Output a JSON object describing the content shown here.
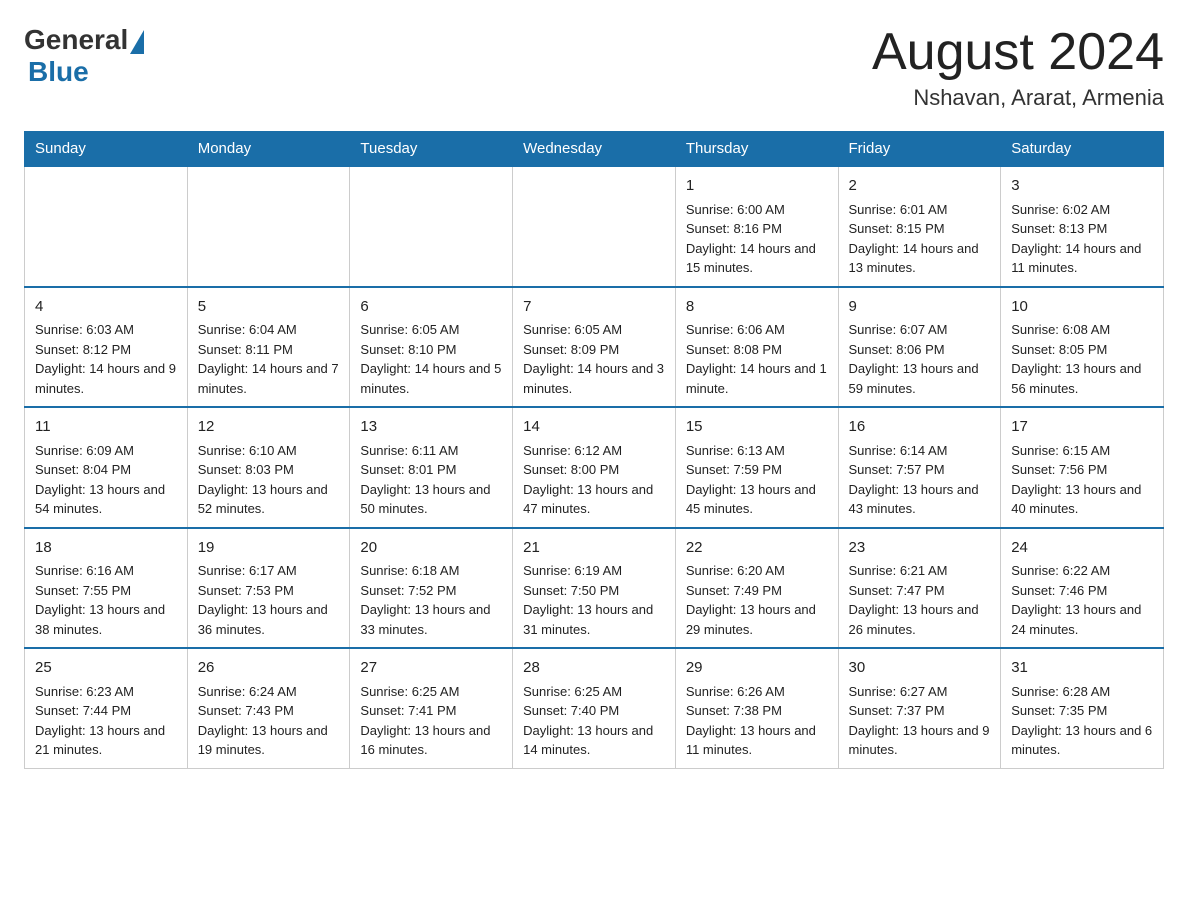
{
  "header": {
    "logo_general": "General",
    "logo_blue": "Blue",
    "title": "August 2024",
    "location": "Nshavan, Ararat, Armenia"
  },
  "days_of_week": [
    "Sunday",
    "Monday",
    "Tuesday",
    "Wednesday",
    "Thursday",
    "Friday",
    "Saturday"
  ],
  "weeks": [
    [
      {
        "day": "",
        "info": ""
      },
      {
        "day": "",
        "info": ""
      },
      {
        "day": "",
        "info": ""
      },
      {
        "day": "",
        "info": ""
      },
      {
        "day": "1",
        "info": "Sunrise: 6:00 AM\nSunset: 8:16 PM\nDaylight: 14 hours and 15 minutes."
      },
      {
        "day": "2",
        "info": "Sunrise: 6:01 AM\nSunset: 8:15 PM\nDaylight: 14 hours and 13 minutes."
      },
      {
        "day": "3",
        "info": "Sunrise: 6:02 AM\nSunset: 8:13 PM\nDaylight: 14 hours and 11 minutes."
      }
    ],
    [
      {
        "day": "4",
        "info": "Sunrise: 6:03 AM\nSunset: 8:12 PM\nDaylight: 14 hours and 9 minutes."
      },
      {
        "day": "5",
        "info": "Sunrise: 6:04 AM\nSunset: 8:11 PM\nDaylight: 14 hours and 7 minutes."
      },
      {
        "day": "6",
        "info": "Sunrise: 6:05 AM\nSunset: 8:10 PM\nDaylight: 14 hours and 5 minutes."
      },
      {
        "day": "7",
        "info": "Sunrise: 6:05 AM\nSunset: 8:09 PM\nDaylight: 14 hours and 3 minutes."
      },
      {
        "day": "8",
        "info": "Sunrise: 6:06 AM\nSunset: 8:08 PM\nDaylight: 14 hours and 1 minute."
      },
      {
        "day": "9",
        "info": "Sunrise: 6:07 AM\nSunset: 8:06 PM\nDaylight: 13 hours and 59 minutes."
      },
      {
        "day": "10",
        "info": "Sunrise: 6:08 AM\nSunset: 8:05 PM\nDaylight: 13 hours and 56 minutes."
      }
    ],
    [
      {
        "day": "11",
        "info": "Sunrise: 6:09 AM\nSunset: 8:04 PM\nDaylight: 13 hours and 54 minutes."
      },
      {
        "day": "12",
        "info": "Sunrise: 6:10 AM\nSunset: 8:03 PM\nDaylight: 13 hours and 52 minutes."
      },
      {
        "day": "13",
        "info": "Sunrise: 6:11 AM\nSunset: 8:01 PM\nDaylight: 13 hours and 50 minutes."
      },
      {
        "day": "14",
        "info": "Sunrise: 6:12 AM\nSunset: 8:00 PM\nDaylight: 13 hours and 47 minutes."
      },
      {
        "day": "15",
        "info": "Sunrise: 6:13 AM\nSunset: 7:59 PM\nDaylight: 13 hours and 45 minutes."
      },
      {
        "day": "16",
        "info": "Sunrise: 6:14 AM\nSunset: 7:57 PM\nDaylight: 13 hours and 43 minutes."
      },
      {
        "day": "17",
        "info": "Sunrise: 6:15 AM\nSunset: 7:56 PM\nDaylight: 13 hours and 40 minutes."
      }
    ],
    [
      {
        "day": "18",
        "info": "Sunrise: 6:16 AM\nSunset: 7:55 PM\nDaylight: 13 hours and 38 minutes."
      },
      {
        "day": "19",
        "info": "Sunrise: 6:17 AM\nSunset: 7:53 PM\nDaylight: 13 hours and 36 minutes."
      },
      {
        "day": "20",
        "info": "Sunrise: 6:18 AM\nSunset: 7:52 PM\nDaylight: 13 hours and 33 minutes."
      },
      {
        "day": "21",
        "info": "Sunrise: 6:19 AM\nSunset: 7:50 PM\nDaylight: 13 hours and 31 minutes."
      },
      {
        "day": "22",
        "info": "Sunrise: 6:20 AM\nSunset: 7:49 PM\nDaylight: 13 hours and 29 minutes."
      },
      {
        "day": "23",
        "info": "Sunrise: 6:21 AM\nSunset: 7:47 PM\nDaylight: 13 hours and 26 minutes."
      },
      {
        "day": "24",
        "info": "Sunrise: 6:22 AM\nSunset: 7:46 PM\nDaylight: 13 hours and 24 minutes."
      }
    ],
    [
      {
        "day": "25",
        "info": "Sunrise: 6:23 AM\nSunset: 7:44 PM\nDaylight: 13 hours and 21 minutes."
      },
      {
        "day": "26",
        "info": "Sunrise: 6:24 AM\nSunset: 7:43 PM\nDaylight: 13 hours and 19 minutes."
      },
      {
        "day": "27",
        "info": "Sunrise: 6:25 AM\nSunset: 7:41 PM\nDaylight: 13 hours and 16 minutes."
      },
      {
        "day": "28",
        "info": "Sunrise: 6:25 AM\nSunset: 7:40 PM\nDaylight: 13 hours and 14 minutes."
      },
      {
        "day": "29",
        "info": "Sunrise: 6:26 AM\nSunset: 7:38 PM\nDaylight: 13 hours and 11 minutes."
      },
      {
        "day": "30",
        "info": "Sunrise: 6:27 AM\nSunset: 7:37 PM\nDaylight: 13 hours and 9 minutes."
      },
      {
        "day": "31",
        "info": "Sunrise: 6:28 AM\nSunset: 7:35 PM\nDaylight: 13 hours and 6 minutes."
      }
    ]
  ]
}
